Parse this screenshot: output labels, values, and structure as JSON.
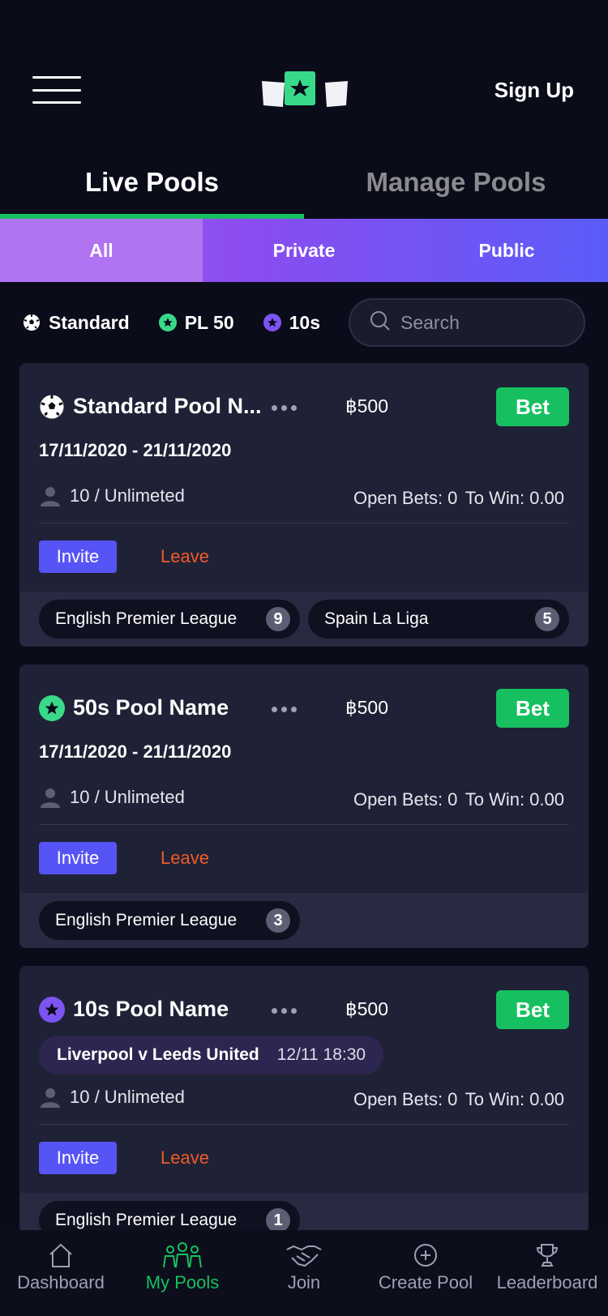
{
  "header": {
    "sign_up": "Sign Up"
  },
  "main_tabs": [
    {
      "label": "Live Pools",
      "active": true
    },
    {
      "label": "Manage Pools",
      "active": false
    }
  ],
  "sub_tabs": [
    {
      "label": "All",
      "active": true
    },
    {
      "label": "Private",
      "active": false
    },
    {
      "label": "Public",
      "active": false
    }
  ],
  "filters": [
    {
      "label": "Standard",
      "icon": "soccer-ball-icon"
    },
    {
      "label": "PL 50",
      "icon": "green-star-icon"
    },
    {
      "label": "10s",
      "icon": "purple-star-icon"
    }
  ],
  "search": {
    "placeholder": "Search"
  },
  "pools": [
    {
      "icon": "soccer-ball-icon",
      "name": "Standard Pool N...",
      "amount": "฿500",
      "bet_label": "Bet",
      "dates": "17/11/2020 - 21/11/2020",
      "members": "10 / Unlimeted",
      "open_bets": "Open Bets: 0",
      "to_win": "To Win: 0.00",
      "invite_label": "Invite",
      "leave_label": "Leave",
      "leagues": [
        {
          "name": "English Premier League",
          "count": "9"
        },
        {
          "name": "Spain La Liga",
          "count": "5"
        }
      ]
    },
    {
      "icon": "green-star-icon",
      "name": "50s Pool Name",
      "amount": "฿500",
      "bet_label": "Bet",
      "dates": "17/11/2020 - 21/11/2020",
      "members": "10 / Unlimeted",
      "open_bets": "Open Bets: 0",
      "to_win": "To Win: 0.00",
      "invite_label": "Invite",
      "leave_label": "Leave",
      "leagues": [
        {
          "name": "English Premier League",
          "count": "3"
        }
      ]
    },
    {
      "icon": "purple-star-icon",
      "name": "10s Pool Name",
      "amount": "฿500",
      "bet_label": "Bet",
      "match": {
        "teams": "Liverpool v Leeds United",
        "time": "12/11 18:30"
      },
      "members": "10 / Unlimeted",
      "open_bets": "Open Bets: 0",
      "to_win": "To Win: 0.00",
      "invite_label": "Invite",
      "leave_label": "Leave",
      "leagues": [
        {
          "name": "English Premier League",
          "count": "1"
        }
      ]
    }
  ],
  "bottom_nav": [
    {
      "label": "Dashboard",
      "icon": "home-icon",
      "active": false
    },
    {
      "label": "My Pools",
      "icon": "people-icon",
      "active": true
    },
    {
      "label": "Join",
      "icon": "handshake-icon",
      "active": false
    },
    {
      "label": "Create Pool",
      "icon": "plus-circle-icon",
      "active": false
    },
    {
      "label": "Leaderboard",
      "icon": "trophy-icon",
      "active": false
    }
  ],
  "colors": {
    "background": "#0b0c1a",
    "card": "#1f2236",
    "accent_green": "#16c060",
    "accent_purple": "#8b4cf0",
    "invite_blue": "#5754f6",
    "leave_orange": "#f05a28"
  }
}
